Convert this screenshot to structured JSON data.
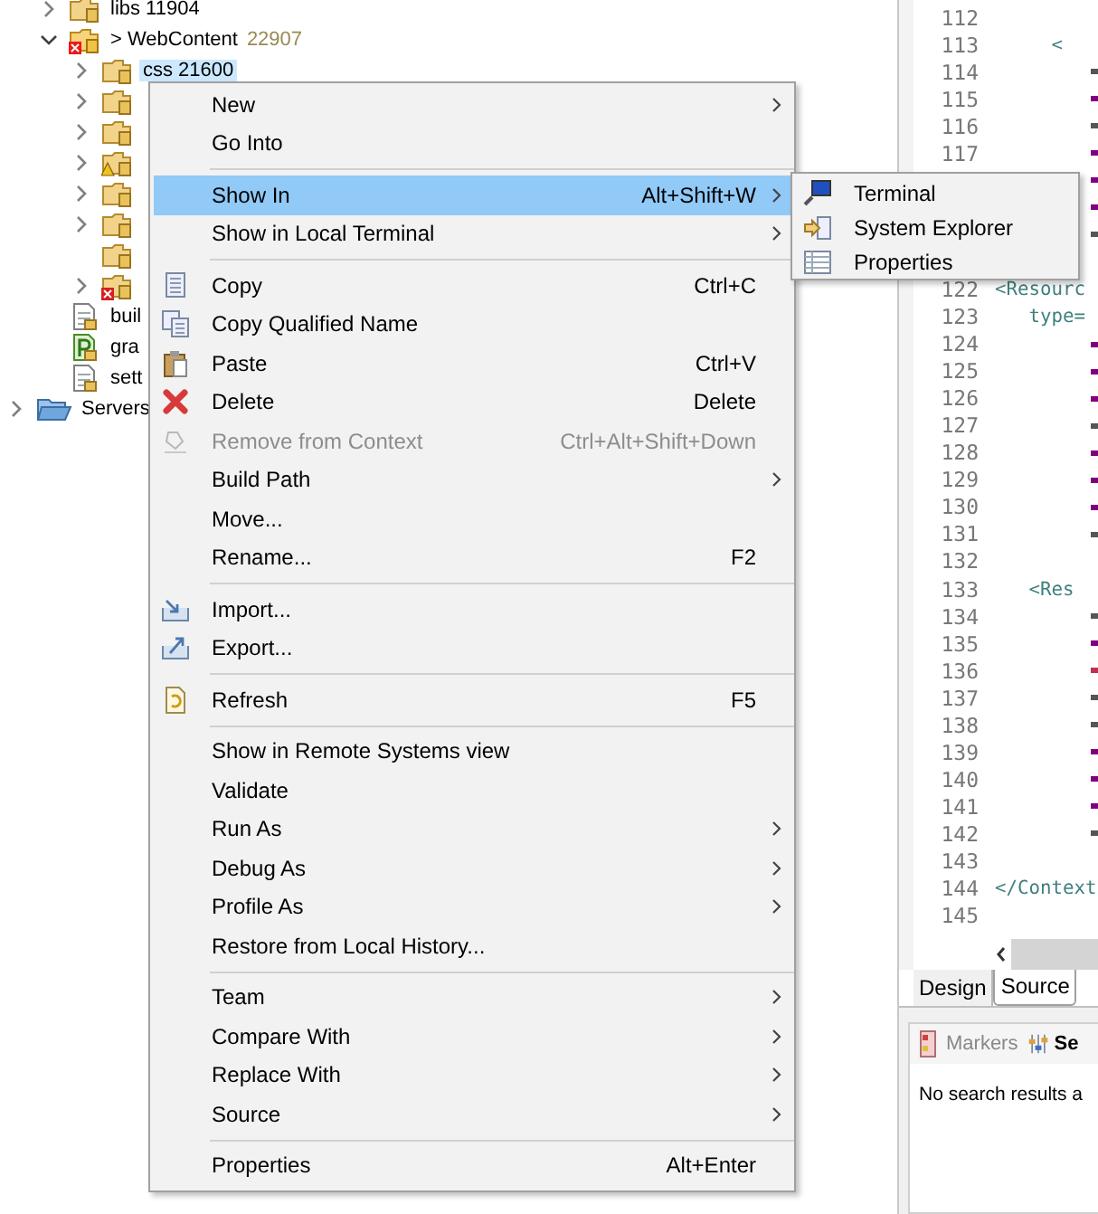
{
  "tree": {
    "items": [
      {
        "children": [
          {
            "kind": "folder",
            "label": "libs 11904",
            "expanded": false,
            "selected": false,
            "has_children": true
          },
          {
            "kind": "project-folder",
            "label": "> WebContent",
            "count": "22907",
            "expanded": true,
            "selected": false,
            "has_children": true,
            "error": true,
            "children": [
              {
                "kind": "folder",
                "label": "css 21600",
                "expanded": false,
                "selected": true,
                "has_children": true
              },
              {
                "kind": "folder",
                "expanded": false,
                "has_children": true
              },
              {
                "kind": "folder",
                "expanded": false,
                "has_children": true
              },
              {
                "kind": "folder",
                "expanded": false,
                "has_children": true,
                "warning": true
              },
              {
                "kind": "folder",
                "expanded": false,
                "has_children": true
              },
              {
                "kind": "folder",
                "expanded": false,
                "has_children": true
              },
              {
                "kind": "folder",
                "has_children": false
              },
              {
                "kind": "folder",
                "expanded": false,
                "has_children": true,
                "error": true
              }
            ]
          },
          {
            "kind": "file",
            "label": "buil",
            "selected": false,
            "has_children": false
          },
          {
            "kind": "script",
            "label": "gra",
            "selected": false,
            "has_children": false
          },
          {
            "kind": "file",
            "label": "sett",
            "selected": false,
            "has_children": false
          }
        ]
      },
      {
        "kind": "servers",
        "label": "Servers",
        "expanded": false,
        "selected": false,
        "has_children": true
      }
    ]
  },
  "editor": {
    "lines": [
      {
        "number": "112"
      },
      {
        "number": "113",
        "code": "     <"
      },
      {
        "number": "114",
        "color": "#555555"
      },
      {
        "number": "115",
        "color": "#7f007f"
      },
      {
        "number": "116",
        "color": "#555555"
      },
      {
        "number": "117",
        "color": "#7f007f"
      },
      {
        "color": "#7f007f"
      },
      {
        "color": "#7f007f"
      },
      {
        "color": "#555555"
      },
      {
        "kind": "blank"
      },
      {
        "number": "122",
        "code": "<Resourc"
      },
      {
        "number": "123",
        "code": "   type="
      },
      {
        "number": "124",
        "color": "#7f007f"
      },
      {
        "number": "125",
        "color": "#7f007f"
      },
      {
        "number": "126",
        "color": "#7f007f"
      },
      {
        "number": "127",
        "color": "#555555"
      },
      {
        "number": "128",
        "color": "#7f007f"
      },
      {
        "number": "129",
        "color": "#7f007f"
      },
      {
        "number": "130",
        "color": "#7f007f"
      },
      {
        "number": "131",
        "color": "#555555"
      },
      {
        "number": "132"
      },
      {
        "number": "133",
        "code": "   <Res"
      },
      {
        "number": "134",
        "color": "#555555"
      },
      {
        "number": "135",
        "color": "#7f007f"
      },
      {
        "number": "136",
        "color": "#c0304f"
      },
      {
        "number": "137",
        "color": "#555555"
      },
      {
        "number": "138",
        "color": "#555555"
      },
      {
        "number": "139",
        "color": "#7f007f"
      },
      {
        "number": "140",
        "color": "#7f007f"
      },
      {
        "number": "141",
        "color": "#7f007f"
      },
      {
        "number": "142",
        "color": "#555555"
      },
      {
        "number": "143"
      },
      {
        "number": "144",
        "code": "</Context"
      },
      {
        "number": "145"
      }
    ],
    "tabs": [
      {
        "label": "Design",
        "selected": false
      },
      {
        "label": "Source",
        "selected": true
      }
    ]
  },
  "bottom_panel": {
    "tabs": [
      {
        "label": "Markers",
        "selected": false
      },
      {
        "label": "Se",
        "selected": true
      }
    ],
    "message": "No search results a"
  },
  "context_menu": {
    "items": [
      {
        "kind": "item",
        "label": "New",
        "submenu": true,
        "selected": false,
        "disabled": false
      },
      {
        "kind": "item",
        "label": "Go Into",
        "selected": false,
        "disabled": false
      },
      {
        "kind": "separator"
      },
      {
        "kind": "item",
        "label": "Show In",
        "shortcut": "Alt+Shift+W",
        "submenu": true,
        "selected": true,
        "disabled": false
      },
      {
        "kind": "item",
        "label": "Show in Local Terminal",
        "submenu": true,
        "selected": false,
        "disabled": false
      },
      {
        "kind": "separator"
      },
      {
        "kind": "item",
        "label": "Copy",
        "shortcut": "Ctrl+C",
        "selected": false,
        "disabled": false
      },
      {
        "kind": "item",
        "label": "Copy Qualified Name",
        "selected": false,
        "disabled": false
      },
      {
        "kind": "item",
        "label": "Paste",
        "shortcut": "Ctrl+V",
        "selected": false,
        "disabled": false
      },
      {
        "kind": "item",
        "label": "Delete",
        "shortcut": "Delete",
        "selected": false,
        "disabled": false
      },
      {
        "kind": "item",
        "label": "Remove from Context",
        "shortcut": "Ctrl+Alt+Shift+Down",
        "selected": false,
        "disabled": true
      },
      {
        "kind": "item",
        "label": "Build Path",
        "submenu": true,
        "selected": false,
        "disabled": false
      },
      {
        "kind": "item",
        "label": "Move...",
        "selected": false,
        "disabled": false
      },
      {
        "kind": "item",
        "label": "Rename...",
        "shortcut": "F2",
        "selected": false,
        "disabled": false
      },
      {
        "kind": "separator"
      },
      {
        "kind": "item",
        "label": "Import...",
        "selected": false,
        "disabled": false
      },
      {
        "kind": "item",
        "label": "Export...",
        "selected": false,
        "disabled": false
      },
      {
        "kind": "separator"
      },
      {
        "kind": "item",
        "label": "Refresh",
        "shortcut": "F5",
        "selected": false,
        "disabled": false
      },
      {
        "kind": "separator"
      },
      {
        "kind": "item",
        "label": "Show in Remote Systems view",
        "selected": false,
        "disabled": false
      },
      {
        "kind": "item",
        "label": "Validate",
        "selected": false,
        "disabled": false
      },
      {
        "kind": "item",
        "label": "Run As",
        "submenu": true,
        "selected": false,
        "disabled": false
      },
      {
        "kind": "item",
        "label": "Debug As",
        "submenu": true,
        "selected": false,
        "disabled": false
      },
      {
        "kind": "item",
        "label": "Profile As",
        "submenu": true,
        "selected": false,
        "disabled": false
      },
      {
        "kind": "item",
        "label": "Restore from Local History...",
        "selected": false,
        "disabled": false
      },
      {
        "kind": "separator"
      },
      {
        "kind": "item",
        "label": "Team",
        "submenu": true,
        "selected": false,
        "disabled": false
      },
      {
        "kind": "item",
        "label": "Compare With",
        "submenu": true,
        "selected": false,
        "disabled": false
      },
      {
        "kind": "item",
        "label": "Replace With",
        "submenu": true,
        "selected": false,
        "disabled": false
      },
      {
        "kind": "item",
        "label": "Source",
        "submenu": true,
        "selected": false,
        "disabled": false
      },
      {
        "kind": "separator"
      },
      {
        "kind": "item",
        "label": "Properties",
        "shortcut": "Alt+Enter",
        "selected": false,
        "disabled": false
      }
    ]
  },
  "submenu": {
    "items": [
      {
        "label": "Terminal",
        "selected": false
      },
      {
        "label": "System Explorer",
        "selected": false
      },
      {
        "label": "Properties",
        "selected": false
      }
    ]
  }
}
